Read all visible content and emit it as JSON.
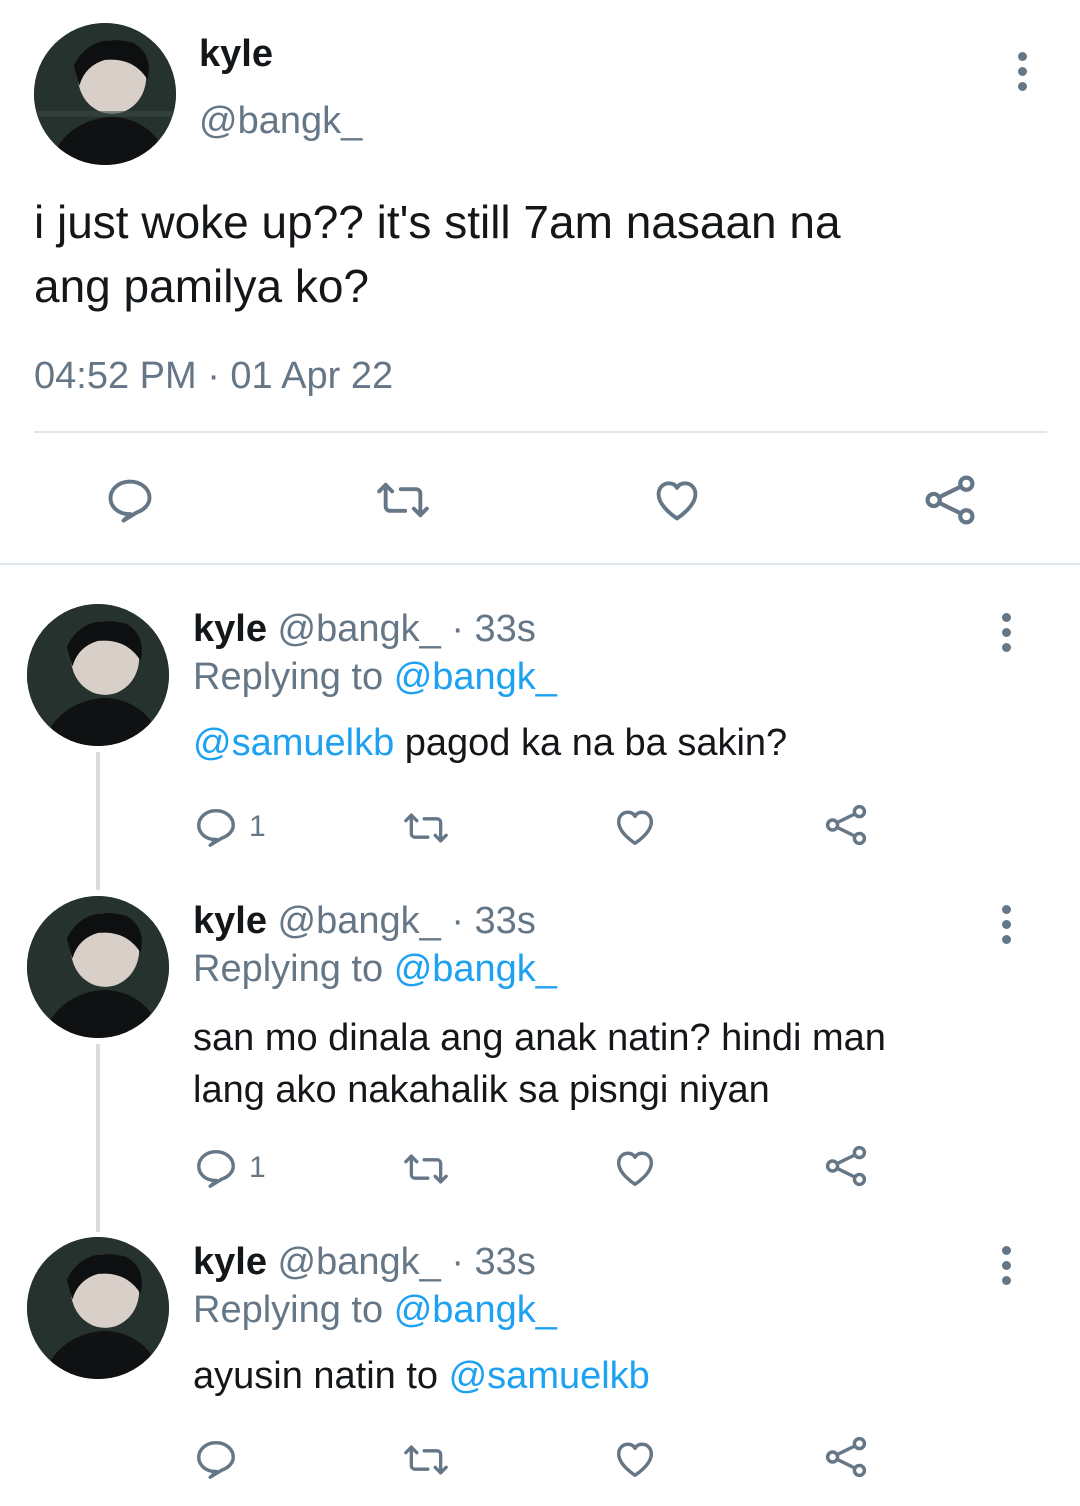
{
  "main_tweet": {
    "display_name": "kyle",
    "handle": "@bangk_",
    "text_line1": "i just woke up?? it's still 7am nasaan na",
    "text_line2": "ang pamilya ko?",
    "timestamp": "04:52 PM · 01 Apr 22"
  },
  "replies": [
    {
      "display_name": "kyle",
      "handle_time": "@bangk_ · 33s",
      "replying_prefix": "Replying to",
      "replying_handle": "@bangk_",
      "mention": "@samuelkb",
      "text": " pagod ka na ba sakin?",
      "reply_count": "1"
    },
    {
      "display_name": "kyle",
      "handle_time": "@bangk_ · 33s",
      "replying_prefix": "Replying to",
      "replying_handle": "@bangk_",
      "text_line1": "san mo dinala ang anak natin? hindi man",
      "text_line2": "lang ako nakahalik sa pisngi niyan",
      "reply_count": "1"
    },
    {
      "display_name": "kyle",
      "handle_time": "@bangk_ · 33s",
      "replying_prefix": "Replying to",
      "replying_handle": "@bangk_",
      "text": "ayusin natin to ",
      "mention": "@samuelkb",
      "reply_count": ""
    }
  ],
  "colors": {
    "link": "#1da1f2",
    "muted": "#657786",
    "divider": "#e1e8ed",
    "thread_line": "#d9dde0"
  },
  "icons": [
    "more-vert-icon",
    "reply-icon",
    "retweet-icon",
    "like-icon",
    "share-icon"
  ]
}
